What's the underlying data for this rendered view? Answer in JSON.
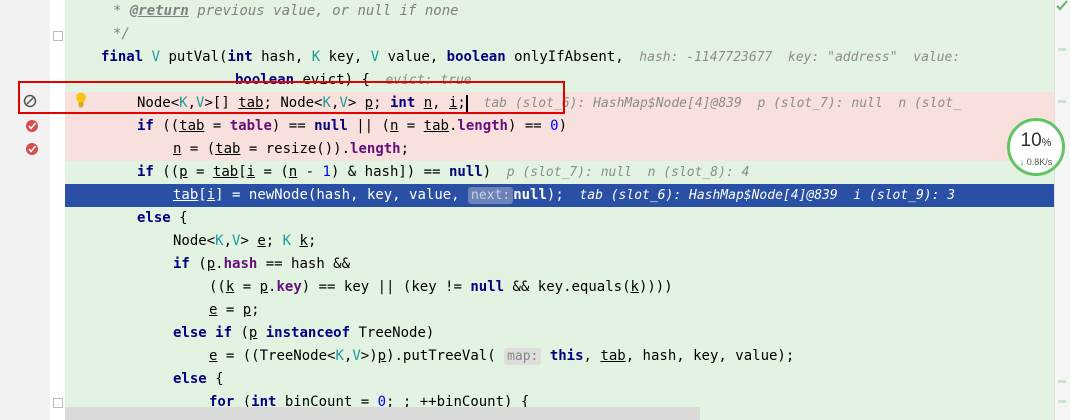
{
  "editor": {
    "lines": [
      {
        "id": "l0",
        "parts": [
          {
            "t": "* ",
            "c": "c"
          },
          {
            "t": "@return",
            "c": "tag"
          },
          {
            "t": " previous value, or null if none",
            "c": "c"
          }
        ]
      },
      {
        "id": "l1",
        "parts": [
          {
            "t": "*/",
            "c": "c"
          }
        ]
      },
      {
        "id": "l2",
        "parts": [
          {
            "t": "final ",
            "c": "k"
          },
          {
            "t": "V",
            "c": "tf"
          },
          {
            "t": " putVal("
          },
          {
            "t": "int ",
            "c": "k"
          },
          {
            "t": "hash, "
          },
          {
            "t": "K",
            "c": "tf"
          },
          {
            "t": " key, "
          },
          {
            "t": "V",
            "c": "tf"
          },
          {
            "t": " value, "
          },
          {
            "t": "boolean ",
            "c": "k"
          },
          {
            "t": "onlyIfAbsent,"
          },
          {
            "t": "  hash: -1147723677  key: \"address\"  value:",
            "c": "hint"
          }
        ]
      },
      {
        "id": "l3",
        "parts": [
          {
            "t": "boolean ",
            "c": "k"
          },
          {
            "t": "evict) {"
          },
          {
            "t": "  evict: true",
            "c": "hint"
          }
        ]
      },
      {
        "id": "l4",
        "parts": [
          {
            "t": "Node<"
          },
          {
            "t": "K",
            "c": "tf"
          },
          {
            "t": ","
          },
          {
            "t": "V",
            "c": "tf"
          },
          {
            "t": ">[] "
          },
          {
            "t": "tab",
            "c": "ul"
          },
          {
            "t": "; Node<"
          },
          {
            "t": "K",
            "c": "tf"
          },
          {
            "t": ","
          },
          {
            "t": "V",
            "c": "tf"
          },
          {
            "t": "> "
          },
          {
            "t": "p",
            "c": "ul"
          },
          {
            "t": "; "
          },
          {
            "t": "int ",
            "c": "k"
          },
          {
            "t": "n",
            "c": "ul"
          },
          {
            "t": ", "
          },
          {
            "t": "i",
            "c": "ul"
          },
          {
            "t": ";"
          },
          {
            "t": "",
            "c": "caret"
          },
          {
            "t": "  tab (slot_6): HashMap$Node[4]@839  p (slot_7): null  n (slot_",
            "c": "hint"
          }
        ]
      },
      {
        "id": "l5",
        "parts": [
          {
            "t": "if ",
            "c": "k"
          },
          {
            "t": "(("
          },
          {
            "t": "tab",
            "c": "ul"
          },
          {
            "t": " = "
          },
          {
            "t": "table",
            "c": "fld"
          },
          {
            "t": ") == "
          },
          {
            "t": "null",
            "c": "k"
          },
          {
            "t": " || ("
          },
          {
            "t": "n",
            "c": "ul"
          },
          {
            "t": " = "
          },
          {
            "t": "tab",
            "c": "ul"
          },
          {
            "t": "."
          },
          {
            "t": "length",
            "c": "fld"
          },
          {
            "t": ") == "
          },
          {
            "t": "0",
            "c": "num"
          },
          {
            "t": ")"
          }
        ]
      },
      {
        "id": "l6",
        "parts": [
          {
            "t": "n",
            "c": "ul"
          },
          {
            "t": " = ("
          },
          {
            "t": "tab",
            "c": "ul"
          },
          {
            "t": " = resize())."
          },
          {
            "t": "length",
            "c": "fld"
          },
          {
            "t": ";"
          }
        ]
      },
      {
        "id": "l7",
        "parts": [
          {
            "t": "if ",
            "c": "k"
          },
          {
            "t": "(("
          },
          {
            "t": "p",
            "c": "ul"
          },
          {
            "t": " = "
          },
          {
            "t": "tab",
            "c": "ul"
          },
          {
            "t": "["
          },
          {
            "t": "i",
            "c": "ul"
          },
          {
            "t": " = ("
          },
          {
            "t": "n",
            "c": "ul"
          },
          {
            "t": " - "
          },
          {
            "t": "1",
            "c": "num"
          },
          {
            "t": ") & hash]) == "
          },
          {
            "t": "null",
            "c": "k"
          },
          {
            "t": ")"
          },
          {
            "t": "  p (slot_7): null  n (slot_8): 4",
            "c": "hint"
          }
        ]
      },
      {
        "id": "l8",
        "parts": [
          {
            "t": "tab",
            "c": "ul"
          },
          {
            "t": "["
          },
          {
            "t": "i",
            "c": "ul"
          },
          {
            "t": "] = newNode(hash, key, value, "
          },
          {
            "t": "next:",
            "c": "phint"
          },
          {
            "t": "null",
            "c": "k"
          },
          {
            "t": ");"
          },
          {
            "t": "  tab (slot_6): HashMap$Node[4]@839  i (slot_9): 3",
            "c": "hint"
          }
        ]
      },
      {
        "id": "l9",
        "parts": [
          {
            "t": "else ",
            "c": "k"
          },
          {
            "t": "{"
          }
        ]
      },
      {
        "id": "l10",
        "parts": [
          {
            "t": "Node<"
          },
          {
            "t": "K",
            "c": "tf"
          },
          {
            "t": ","
          },
          {
            "t": "V",
            "c": "tf"
          },
          {
            "t": "> "
          },
          {
            "t": "e",
            "c": "ul"
          },
          {
            "t": "; "
          },
          {
            "t": "K",
            "c": "tf"
          },
          {
            "t": " "
          },
          {
            "t": "k",
            "c": "ul"
          },
          {
            "t": ";"
          }
        ]
      },
      {
        "id": "l11",
        "parts": [
          {
            "t": "if ",
            "c": "k"
          },
          {
            "t": "("
          },
          {
            "t": "p",
            "c": "ul"
          },
          {
            "t": "."
          },
          {
            "t": "hash",
            "c": "fld"
          },
          {
            "t": " == hash &&"
          }
        ]
      },
      {
        "id": "l12",
        "parts": [
          {
            "t": "(("
          },
          {
            "t": "k",
            "c": "ul"
          },
          {
            "t": " = "
          },
          {
            "t": "p",
            "c": "ul"
          },
          {
            "t": "."
          },
          {
            "t": "key",
            "c": "fld"
          },
          {
            "t": ") == key || (key != "
          },
          {
            "t": "null",
            "c": "k"
          },
          {
            "t": " && key.equals("
          },
          {
            "t": "k",
            "c": "ul"
          },
          {
            "t": "))))"
          }
        ]
      },
      {
        "id": "l13",
        "parts": [
          {
            "t": "e",
            "c": "ul"
          },
          {
            "t": " = "
          },
          {
            "t": "p",
            "c": "ul"
          },
          {
            "t": ";"
          }
        ]
      },
      {
        "id": "l14",
        "parts": [
          {
            "t": "else if ",
            "c": "k"
          },
          {
            "t": "("
          },
          {
            "t": "p",
            "c": "ul"
          },
          {
            "t": " "
          },
          {
            "t": "instanceof ",
            "c": "k"
          },
          {
            "t": "TreeNode)"
          }
        ]
      },
      {
        "id": "l15",
        "parts": [
          {
            "t": "e",
            "c": "ul"
          },
          {
            "t": " = ((TreeNode<"
          },
          {
            "t": "K",
            "c": "tf"
          },
          {
            "t": ","
          },
          {
            "t": "V",
            "c": "tf"
          },
          {
            "t": ">)"
          },
          {
            "t": "p",
            "c": "ul"
          },
          {
            "t": ").putTreeVal( "
          },
          {
            "t": "map:",
            "c": "phint"
          },
          {
            "t": " "
          },
          {
            "t": "this",
            "c": "k"
          },
          {
            "t": ", "
          },
          {
            "t": "tab",
            "c": "ul"
          },
          {
            "t": ", hash, key, value);"
          }
        ]
      },
      {
        "id": "l16",
        "parts": [
          {
            "t": "else ",
            "c": "k"
          },
          {
            "t": "{"
          }
        ]
      },
      {
        "id": "l17",
        "parts": [
          {
            "t": "for ",
            "c": "k"
          },
          {
            "t": "("
          },
          {
            "t": "int ",
            "c": "k"
          },
          {
            "t": "binCount = "
          },
          {
            "t": "0",
            "c": "num"
          },
          {
            "t": "; ; ++binCount) {"
          }
        ]
      }
    ]
  },
  "network_widget": {
    "percent": "10",
    "percent_unit": "%",
    "speed": "0.8K/s",
    "speed_icon": "down-arrow-icon",
    "ring_color": "#62c462"
  },
  "gutter": {
    "line4_icon": "disabled-breakpoint-icon",
    "line4_bulb": "intention-bulb-icon",
    "line5_icon": "breakpoint-icon",
    "line6_icon": "breakpoint-icon"
  },
  "colors": {
    "editor_bg": "#e3f3e1",
    "breakpoint_line_bg": "#f8e1dd",
    "execution_line_bg": "#2a50a6",
    "highlight_box": "#e60000"
  }
}
